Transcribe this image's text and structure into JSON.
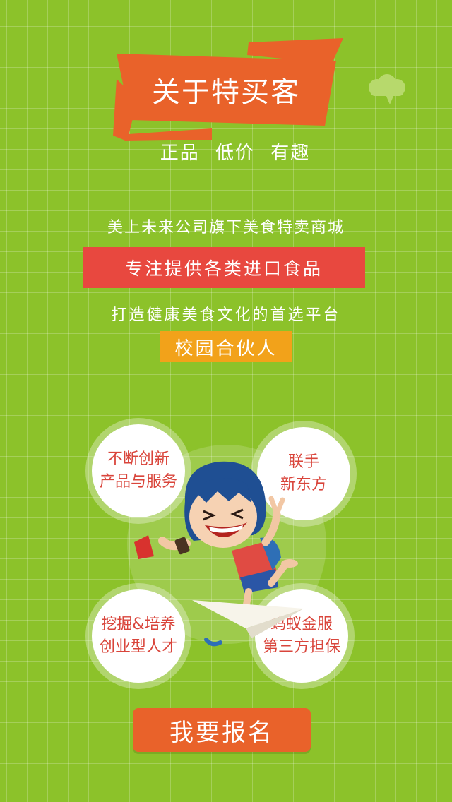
{
  "header": {
    "title": "关于特买客",
    "tagline": [
      "正品",
      "低价",
      "有趣"
    ]
  },
  "intro": {
    "line1": "美上未来公司旗下美食特卖商城",
    "highlight": "专注提供各类进口食品",
    "line3": "打造健康美食文化的首选平台",
    "badge": "校园合伙人"
  },
  "features": [
    {
      "line1": "不断创新",
      "line2": "产品与服务"
    },
    {
      "line1": "联手",
      "line2": "新东方"
    },
    {
      "line1": "挖掘&培养",
      "line2": "创业型人才"
    },
    {
      "line1": "蚂蚁金服",
      "line2": "第三方担保"
    }
  ],
  "cta": {
    "label": "我要报名"
  },
  "colors": {
    "background": "#8cc22a",
    "banner": "#e9622a",
    "highlight_box": "#e8483f",
    "badge_box": "#f2a21a",
    "feature_text": "#d9453b"
  },
  "icons": [
    "speech-cloud-icon",
    "mascot-illustration",
    "paper-plane-icon"
  ]
}
